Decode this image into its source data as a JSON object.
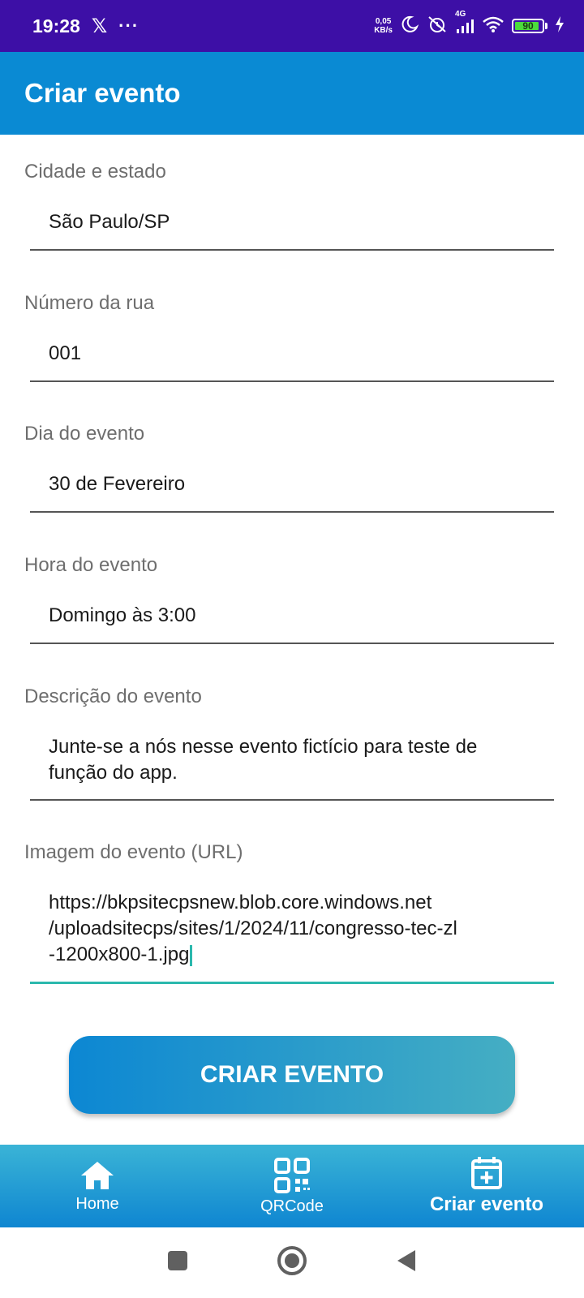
{
  "status_bar": {
    "time": "19:28",
    "net_speed_value": "0,05",
    "net_speed_unit": "KB/s",
    "network": "4G",
    "battery": "90",
    "battery_level": 0.9
  },
  "app_bar": {
    "title": "Criar evento"
  },
  "form": {
    "fields": [
      {
        "label": "Cidade e estado",
        "value": "São Paulo/SP"
      },
      {
        "label": "Número da rua",
        "value": "001"
      },
      {
        "label": "Dia do evento",
        "value": "30 de Fevereiro"
      },
      {
        "label": "Hora do evento",
        "value": "Domingo às 3:00"
      },
      {
        "label": "Descrição do evento",
        "value_lines": [
          "Junte-se a nós nesse evento fictício para teste de",
          "função do app."
        ]
      },
      {
        "label": "Imagem do evento (URL)",
        "value_lines": [
          "https://bkpsitecpsnew.blob.core.windows.net",
          "/uploadsitecps/sites/1/2024/11/congresso-tec-zl",
          "-1200x800-1.jpg"
        ]
      }
    ],
    "submit_label": "CRIAR EVENTO"
  },
  "bottom_nav": {
    "items": [
      {
        "label": "Home",
        "icon": "home-icon"
      },
      {
        "label": "QRCode",
        "icon": "qrcode-icon"
      },
      {
        "label": "Criar evento",
        "icon": "calendar-add-icon",
        "active": true
      }
    ]
  },
  "colors": {
    "status_bar": "#3d0fa6",
    "app_bar": "#0a8ad3",
    "focus_accent": "#2bb8ad",
    "button_start": "#0c87d3",
    "button_end": "#45aec3"
  }
}
